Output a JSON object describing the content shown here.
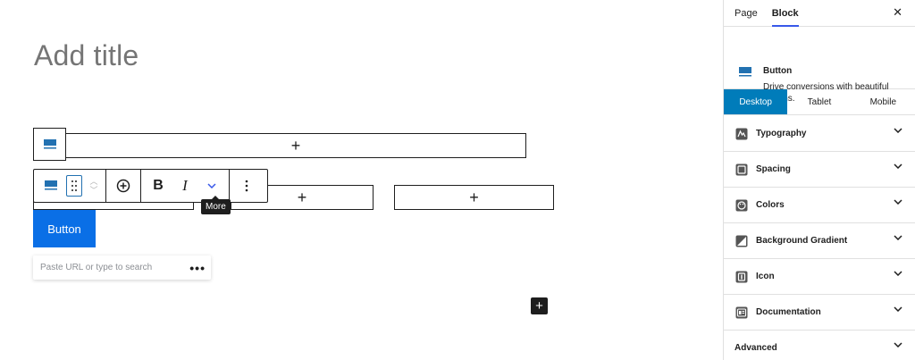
{
  "editor": {
    "title_placeholder": "Add title",
    "toolbar": {
      "tooltip": "More",
      "bold_label": "B",
      "italic_label": "I"
    },
    "button_text": "Button",
    "link_placeholder": "Paste URL or type to search",
    "link_options": "•••",
    "appender_symbol": "+"
  },
  "sidebar": {
    "tabs": [
      "Page",
      "Block"
    ],
    "active_tab": "Block",
    "close_symbol": "✕",
    "block": {
      "name": "Button",
      "description": "Drive conversions with beautiful buttons."
    },
    "device_tabs": [
      "Desktop",
      "Tablet",
      "Mobile"
    ],
    "active_device": "Desktop",
    "panels": [
      {
        "label": "Typography",
        "icon": "typography-icon"
      },
      {
        "label": "Spacing",
        "icon": "spacing-icon"
      },
      {
        "label": "Colors",
        "icon": "palette-icon"
      },
      {
        "label": "Background Gradient",
        "icon": "gradient-icon"
      },
      {
        "label": "Icon",
        "icon": "icon-icon"
      },
      {
        "label": "Documentation",
        "icon": "documentation-icon"
      },
      {
        "label": "Advanced",
        "icon": ""
      }
    ]
  },
  "colors": {
    "accent": "#3858e9",
    "button_bg": "#0a6fe6",
    "device_active": "#007cba"
  }
}
